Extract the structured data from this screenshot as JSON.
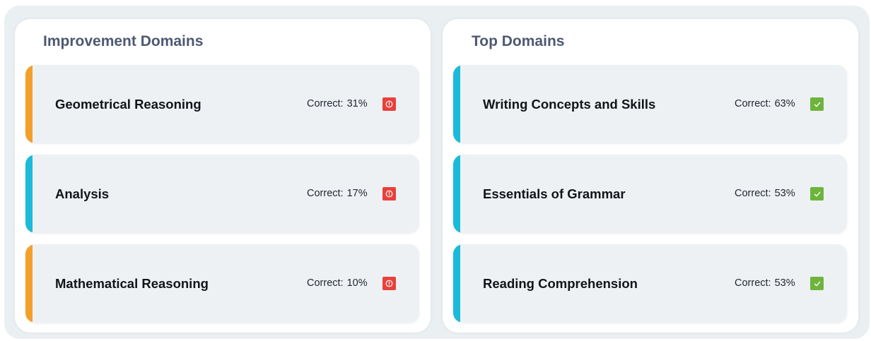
{
  "colors": {
    "accent_orange": "#f2a02a",
    "accent_cyan": "#19bbd9",
    "alert_red": "#e8413b",
    "success_green": "#6eb43c"
  },
  "improvement": {
    "title": "Improvement Domains",
    "correct_label": "Correct:",
    "items": [
      {
        "name": "Geometrical Reasoning",
        "value": "31%",
        "accent": "orange",
        "icon": "alert-icon"
      },
      {
        "name": "Analysis",
        "value": "17%",
        "accent": "cyan",
        "icon": "alert-icon"
      },
      {
        "name": "Mathematical Reasoning",
        "value": "10%",
        "accent": "orange",
        "icon": "alert-icon"
      }
    ]
  },
  "top": {
    "title": "Top Domains",
    "correct_label": "Correct:",
    "items": [
      {
        "name": "Writing Concepts and Skills",
        "value": "63%",
        "accent": "cyan",
        "icon": "check-icon"
      },
      {
        "name": "Essentials of Grammar",
        "value": "53%",
        "accent": "cyan",
        "icon": "check-icon"
      },
      {
        "name": "Reading Comprehension",
        "value": "53%",
        "accent": "cyan",
        "icon": "check-icon"
      }
    ]
  }
}
